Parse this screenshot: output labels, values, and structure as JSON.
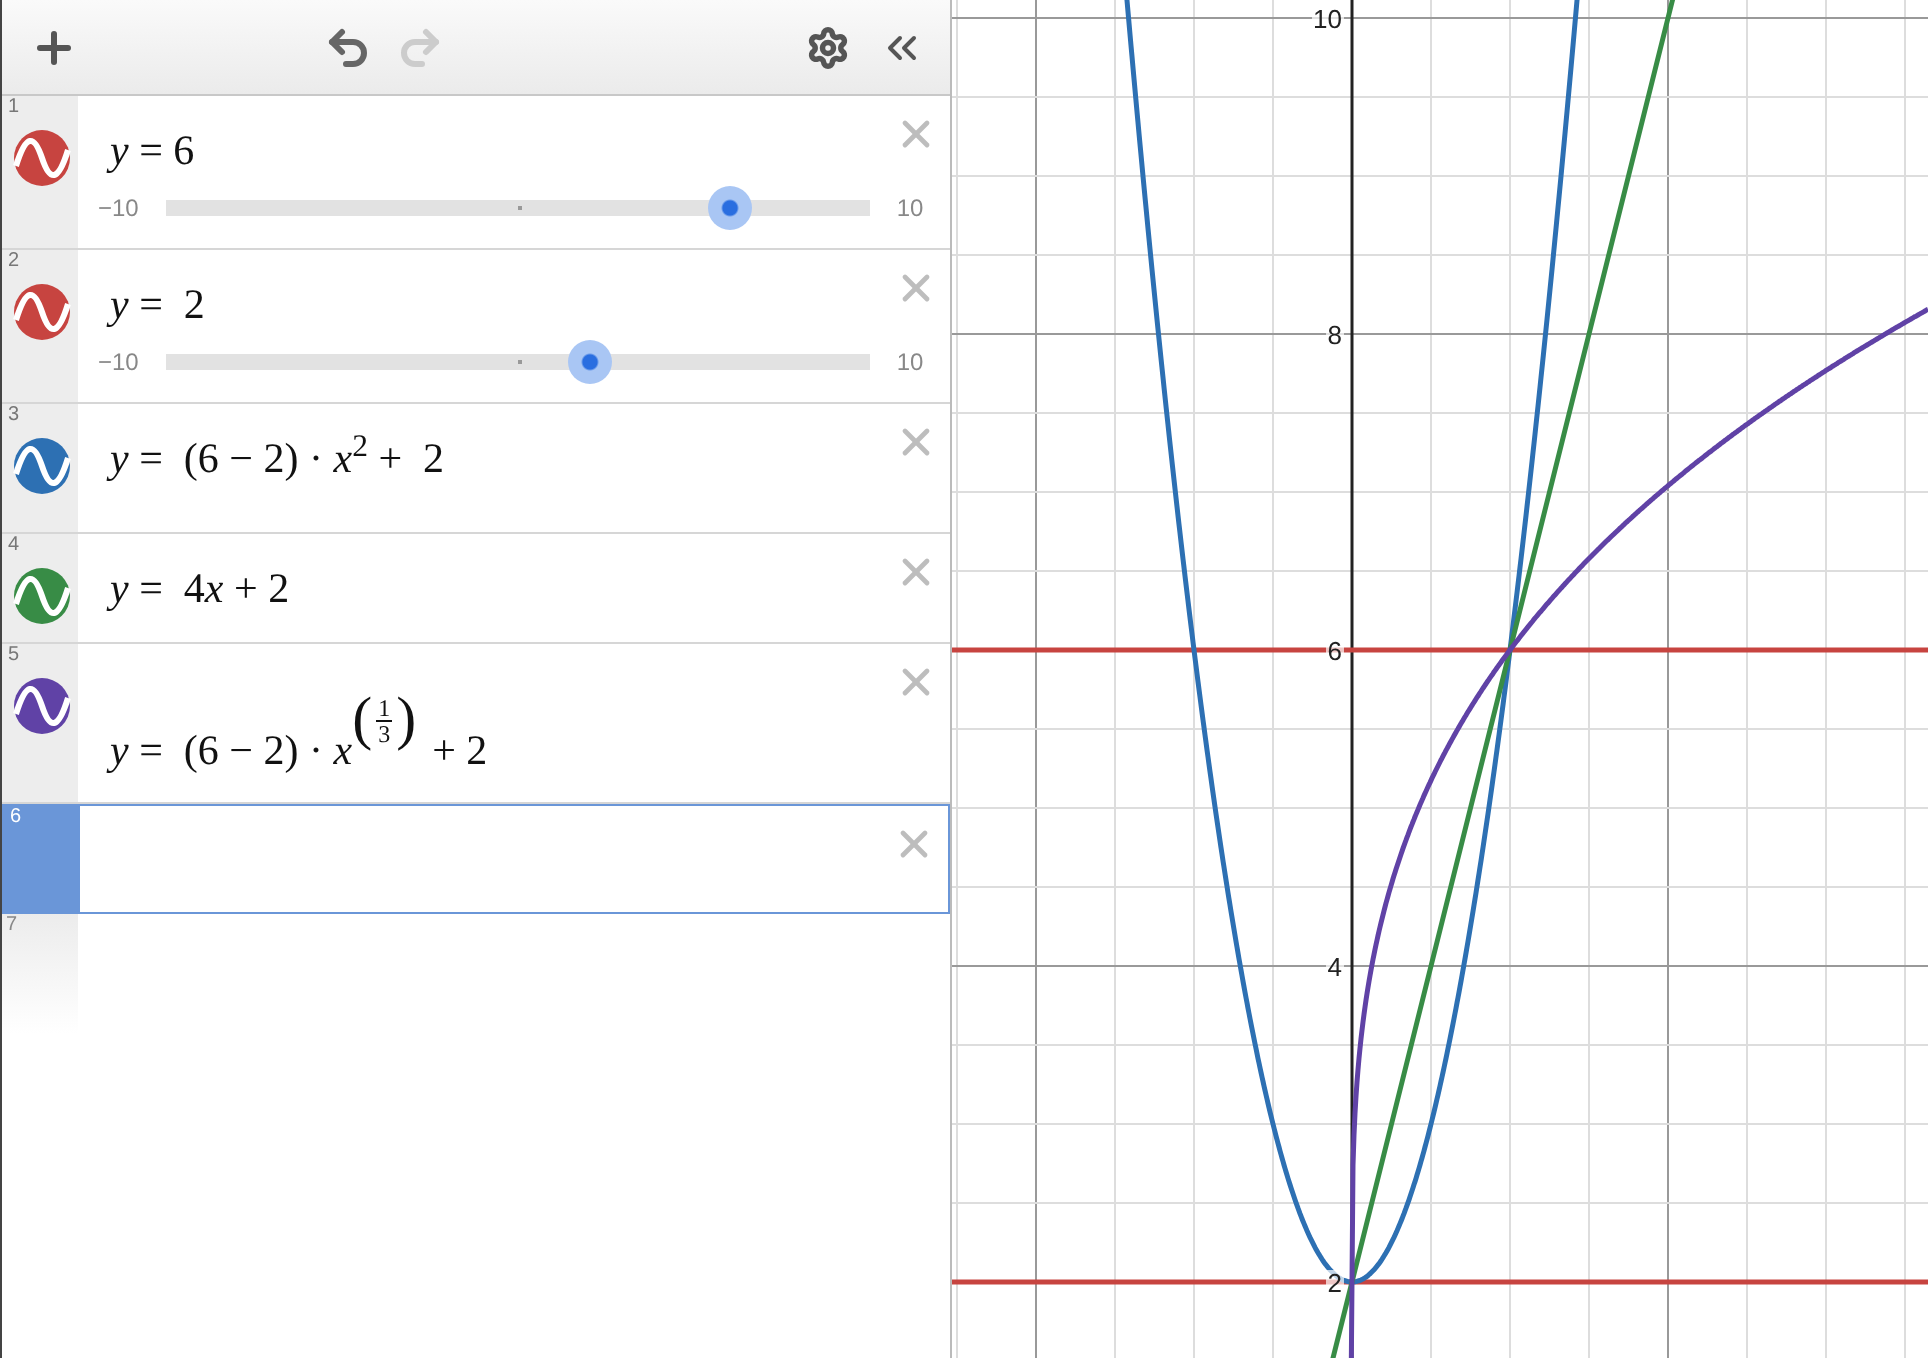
{
  "expressions": [
    {
      "kind": "slider",
      "number": "1",
      "color": "#c74440",
      "selected": false,
      "math": [
        {
          "kind": "text",
          "text": "*y* = 6"
        }
      ],
      "slider": {
        "min": "−10",
        "max": "10",
        "level": 0.8
      }
    },
    {
      "kind": "slider",
      "number": "2",
      "color": "#c74440",
      "selected": false,
      "math": [
        {
          "kind": "text",
          "text": "*y* =  2"
        }
      ],
      "slider": {
        "min": "−10",
        "max": "10",
        "level": 0.6
      }
    },
    {
      "kind": "expression",
      "number": "3",
      "color": "#2d70b3",
      "selected": false,
      "math": [
        {
          "kind": "text",
          "text": "*y* =  (6 − 2) · *x*$^{2}$ +  2"
        }
      ]
    },
    {
      "kind": "expression",
      "number": "4",
      "color": "#388c46",
      "selected": false,
      "math": [
        {
          "kind": "text",
          "text": "*y* =  4"
        },
        {
          "kind": "text",
          "text": "*x* + 2"
        }
      ]
    },
    {
      "kind": "expression",
      "number": "5",
      "color": "#6042a6",
      "selected": false,
      "math": [
        {
          "kind": "text",
          "text": "*y* =  (6 − 2) · *x*"
        },
        {
          "kind": "frac-power",
          "open": "(",
          "num": "1",
          "den": "3",
          "close": ")"
        },
        {
          "kind": "text",
          "text": "+ 2"
        }
      ]
    },
    {
      "kind": "empty",
      "number": "6",
      "selected": true
    },
    {
      "kind": "blank",
      "number": "7"
    }
  ],
  "graph": {
    "y_ticks": [
      "10",
      "8",
      "6",
      "4",
      "2"
    ]
  }
}
